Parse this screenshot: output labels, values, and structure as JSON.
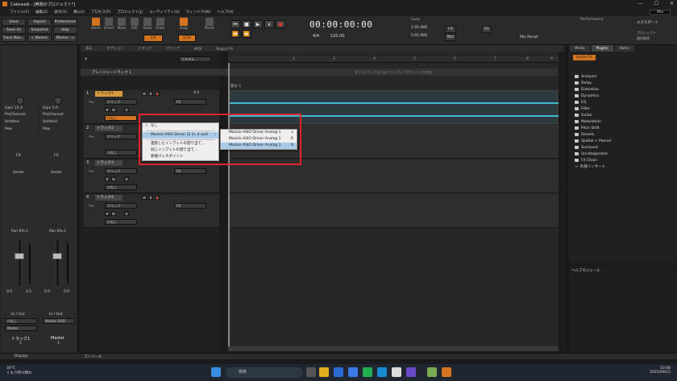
{
  "window": {
    "title": "Cakewalk - [無題のプロジェクト*]",
    "minimize": "—",
    "maximize": "☐",
    "close": "✕"
  },
  "menu": {
    "items": [
      "ファイル(F)",
      "編集(E)",
      "表示(V)",
      "挿入(I)",
      "プロセス(P)",
      "プロジェクト(J)",
      "ユーティリティ(U)",
      "ウィンドウ(W)",
      "ヘルプ(H)"
    ],
    "mixer_label": "Mix"
  },
  "control_bar": {
    "left_buttons": [
      "Save",
      "Import",
      "Preferences",
      "Save As",
      "Snapshot",
      "Help",
      "Track Man...",
      "< Marker",
      "Marker ->"
    ],
    "tools": [
      "Smart",
      "Select",
      "Move",
      "Edit",
      "Draw",
      "Erase"
    ],
    "snap_label": "Snap",
    "snap_value": "1/16",
    "marks_label": "Marks",
    "quant_value": "1/4",
    "time_display": "00:00:00:00",
    "meter": "4/4",
    "tempo": "120.00",
    "loop_label": "Loop",
    "loop_start": "1:01:000",
    "loop_end": "5:01:000",
    "fx_label": "FX",
    "pdc_label": "PDC",
    "mix_recall": "Mix Recall",
    "r1_label": "R1",
    "performance_label": "Performance",
    "export_label": "エクスポート",
    "project_label": "プロジェクト",
    "select_label": "選択範囲"
  },
  "left_mixer": {
    "strips": [
      {
        "gain_label": "Gain",
        "gain": "15.0",
        "pc_name": "ProChannel",
        "preset": "Untitled",
        "pow": "Pow",
        "fx": "FX",
        "sends": "Sends",
        "pan": "Pan  0% C",
        "vol_l": "0.5",
        "vol_r": "4.5",
        "inout": "In / Out",
        "input": "ロなし",
        "output": "Master",
        "name": "トラック1",
        "number": "1"
      },
      {
        "gain_label": "Gain",
        "gain": "5.0",
        "pc_name": "ProChannel",
        "preset": "Untitled",
        "pow": "Pow",
        "fx": "FX",
        "sends": "Sends",
        "pan": "Pan  0% C",
        "vol_l": "0.0",
        "vol_r": "0.0",
        "inout": "In / Out",
        "input": "Mackie ASIO",
        "output": "",
        "name": "Master",
        "number": "1"
      }
    ],
    "display_label": "Display"
  },
  "view_header": {
    "items": [
      "表示",
      "オプション",
      "トラック",
      "クリップ",
      "MIDI",
      "Region FX"
    ],
    "custom_label": "カスタム",
    "hint": "ダブルクリックまたはドラッグしてセクションを追加",
    "arranger_label": "アレンジャートラック 1",
    "section_label": "部分 1"
  },
  "ruler": {
    "ticks": [
      "2",
      "3",
      "4",
      "5",
      "6",
      "7",
      "8",
      "9"
    ]
  },
  "tracks": [
    {
      "number": "1",
      "name": "トラック1",
      "clip": "クリップ",
      "fx": "FX",
      "input": "ロなし",
      "level": "4.5"
    },
    {
      "number": "2",
      "name": "トラック2",
      "clip": "クリップ",
      "fx": "FX",
      "input": "ロなし",
      "level": ""
    },
    {
      "number": "3",
      "name": "トラック3",
      "clip": "クリップ",
      "fx": "FX",
      "input": "ロなし",
      "level": ""
    },
    {
      "number": "4",
      "name": "トラック4",
      "clip": "クリップ",
      "fx": "FX",
      "input": "ロなし",
      "level": ""
    }
  ],
  "track_buttons": {
    "mute": "M",
    "solo": "S",
    "rec": "●",
    "r": "R",
    "w": "W",
    "a": "A"
  },
  "context_menu": {
    "items": [
      "なし",
      "Mackie ASIO Driver (2 in, 4 out)",
      "連続したインプットの割り当て...",
      "同じインプットの割り当て...",
      "新規パッチポイント"
    ],
    "check": "✓",
    "submenu": [
      {
        "label": "Mackie ASIO Driver Analog 1",
        "shortcut": "L"
      },
      {
        "label": "Mackie ASIO Driver Analog 1",
        "shortcut": "R"
      },
      {
        "label": "Mackie ASIO Driver Analog 1",
        "shortcut": "S"
      }
    ]
  },
  "browser": {
    "tabs": [
      "Media",
      "Plugins",
      "Notes"
    ],
    "section": "Audio FX",
    "folders": [
      "Analyzer",
      "Delay",
      "Distortion",
      "Dynamics",
      "EQ",
      "Filter",
      "Guitar",
      "Modulation",
      "Pitch Shift",
      "Reverb",
      "Spatial + Panner",
      "Surround",
      "Uncategorized",
      "FX Chain"
    ],
    "external": "外部インサート",
    "help_title": "ヘルプモジュール"
  },
  "bottom": {
    "console": "コンソール"
  },
  "taskbar": {
    "weather_temp": "30°C",
    "weather_desc": "くもり時々晴れ",
    "search": "検索",
    "time": "10:08",
    "date": "2025/09/15"
  }
}
